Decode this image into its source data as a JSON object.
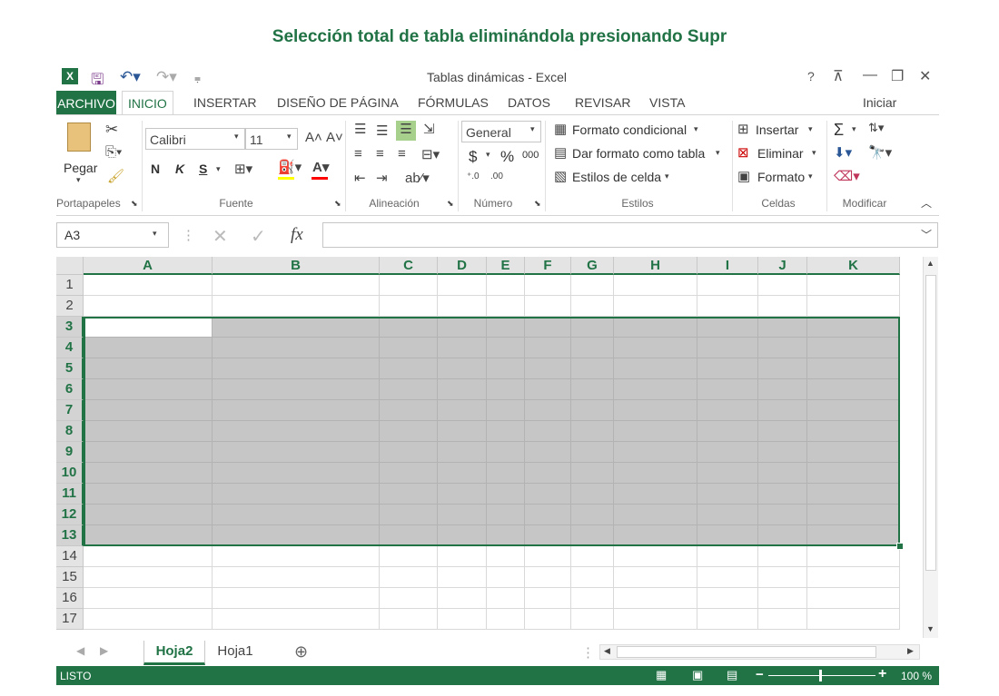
{
  "caption": "Selección total de tabla eliminándola presionando Supr",
  "window": {
    "title": "Tablas dinámicas - Excel",
    "help": "?",
    "signin": "Iniciar sesión"
  },
  "tabs": [
    {
      "label": "ARCHIVO"
    },
    {
      "label": "INICIO"
    },
    {
      "label": "INSERTAR"
    },
    {
      "label": "DISEÑO DE PÁGINA"
    },
    {
      "label": "FÓRMULAS"
    },
    {
      "label": "DATOS"
    },
    {
      "label": "REVISAR"
    },
    {
      "label": "VISTA"
    }
  ],
  "ribbon": {
    "clipboard": {
      "paste_label": "Pegar",
      "group": "Portapapeles"
    },
    "font": {
      "name": "Calibri",
      "size": "11",
      "bold": "N",
      "italic": "K",
      "underline": "S",
      "group": "Fuente"
    },
    "alignment": {
      "group": "Alineación"
    },
    "number": {
      "format": "General",
      "currency": "$",
      "percent": "%",
      "thousands": "000",
      "group": "Número"
    },
    "styles": {
      "conditional": "Formato condicional",
      "as_table": "Dar formato como tabla",
      "cell_styles": "Estilos de celda",
      "group": "Estilos"
    },
    "cells": {
      "insert": "Insertar",
      "delete": "Eliminar",
      "format": "Formato",
      "group": "Celdas"
    },
    "editing": {
      "group": "Modificar",
      "sum": "Σ"
    }
  },
  "formula_bar": {
    "name_box": "A3",
    "fx": "fx",
    "value": ""
  },
  "columns": [
    "A",
    "B",
    "C",
    "D",
    "E",
    "F",
    "G",
    "H",
    "I",
    "J",
    "K"
  ],
  "rows": [
    "1",
    "2",
    "3",
    "4",
    "5",
    "6",
    "7",
    "8",
    "9",
    "10",
    "11",
    "12",
    "13",
    "14",
    "15",
    "16",
    "17"
  ],
  "selection": {
    "range": "A3:K13",
    "active_cell": "A3"
  },
  "sheets": [
    {
      "name": "Hoja2",
      "active": true
    },
    {
      "name": "Hoja1",
      "active": false
    }
  ],
  "status": {
    "mode": "LISTO",
    "zoom": "100 %"
  },
  "colors": {
    "accent": "#217346",
    "selection_fill": "#c6c6c6"
  }
}
